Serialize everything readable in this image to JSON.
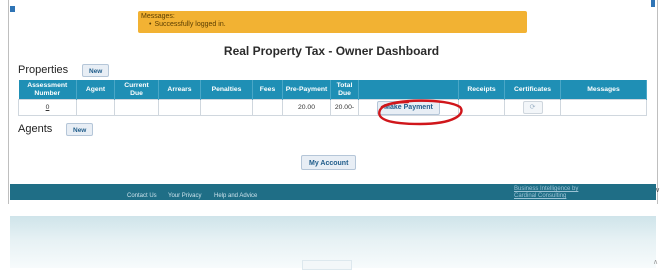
{
  "messages": {
    "title": "Messages:",
    "items": [
      "Successfully logged in."
    ]
  },
  "dashboard": {
    "title": "Real Property Tax - Owner Dashboard"
  },
  "properties": {
    "label": "Properties",
    "new_label": "New",
    "columns": [
      "Assessment Number",
      "Agent",
      "Current Due",
      "Arrears",
      "Penalties",
      "Fees",
      "Pre-Payment",
      "Total Due",
      "",
      "Receipts",
      "Certificates",
      "Messages"
    ],
    "rows": [
      {
        "assessment_number": "0",
        "agent": "",
        "current_due": "",
        "arrears": "",
        "penalties": "",
        "fees": "",
        "pre_payment": "20.00",
        "total_due": "20.00-",
        "action_label": "Make Payment",
        "receipts": "",
        "certificate_icon": "refresh-icon",
        "messages": ""
      }
    ]
  },
  "agents": {
    "label": "Agents",
    "new_label": "New"
  },
  "account": {
    "button_label": "My Account"
  },
  "footer": {
    "links": [
      "Contact Us",
      "Your Privacy",
      "Help and Advice"
    ],
    "credit_line1": "Business Intelligence by",
    "credit_line2": "Cardinal Consulting"
  },
  "colors": {
    "message_bg": "#f2b233",
    "table_header": "#1f8fb5",
    "footer_bg": "#1f6e86",
    "annotation": "#d0161b"
  }
}
